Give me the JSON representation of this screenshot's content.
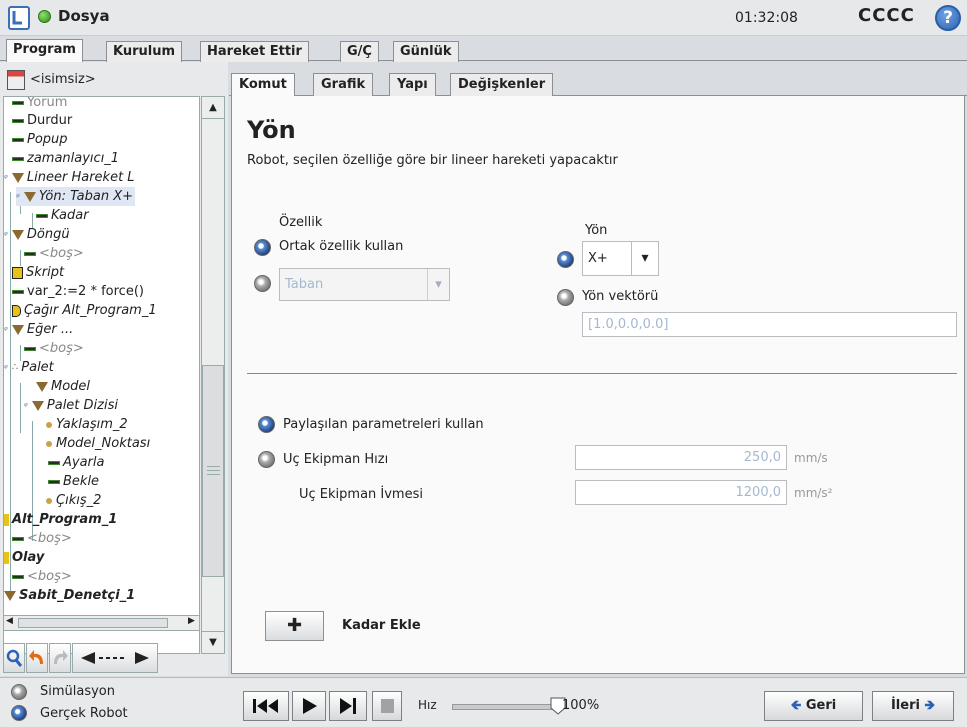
{
  "header": {
    "program_name": "Dosya",
    "clock": "01:32:08",
    "robot_name": "CCCC",
    "help_symbol": "?"
  },
  "main_tabs": [
    "Program",
    "Kurulum",
    "Hareket Ettir",
    "G/Ç",
    "Günlük"
  ],
  "file_name": "<isimsiz>",
  "tree": [
    {
      "label": "Yorum"
    },
    {
      "label": "Durdur"
    },
    {
      "label": "Popup"
    },
    {
      "label": "zamanlayıcı_1"
    },
    {
      "label": "Lineer Hareket L"
    },
    {
      "label": "Yön: Taban X+"
    },
    {
      "label": "Kadar"
    },
    {
      "label": "Döngü"
    },
    {
      "label": "<boş>"
    },
    {
      "label": "Skript"
    },
    {
      "label": "var_2:=2 * force()"
    },
    {
      "label": "Çağır Alt_Program_1"
    },
    {
      "label": "Eğer ..."
    },
    {
      "label": "<boş>"
    },
    {
      "label": "Palet"
    },
    {
      "label": "Model"
    },
    {
      "label": "Palet Dizisi"
    },
    {
      "label": "Yaklaşım_2"
    },
    {
      "label": "Model_Noktası"
    },
    {
      "label": "Ayarla"
    },
    {
      "label": "Bekle"
    },
    {
      "label": "Çıkış_2"
    },
    {
      "label": "Alt_Program_1"
    },
    {
      "label": "<boş>"
    },
    {
      "label": "Olay"
    },
    {
      "label": "<boş>"
    },
    {
      "label": "Sabit_Denetçi_1"
    }
  ],
  "sub_tabs": [
    "Komut",
    "Grafik",
    "Yapı",
    "Değişkenler"
  ],
  "command": {
    "title": "Yön",
    "description": "Robot, seçilen özelliğe göre bir lineer hareketi yapacaktır",
    "feature_label": "Özellik",
    "use_common_feature": "Ortak özellik kullan",
    "feature_value": "Taban",
    "direction_label": "Yön",
    "direction_value": "X+",
    "direction_vector_label": "Yön vektörü",
    "direction_vector_value": "[1.0,0.0,0.0]",
    "shared_params": "Paylaşılan parametreleri kullan",
    "tool_speed_label": "Uç Ekipman Hızı",
    "tool_speed_value": "250,0",
    "tool_speed_unit": "mm/s",
    "tool_accel_label": "Uç Ekipman İvmesi",
    "tool_accel_value": "1200,0",
    "tool_accel_unit": "mm/s²",
    "add_until": "Kadar Ekle"
  },
  "footer": {
    "simulation": "Simülasyon",
    "real_robot": "Gerçek Robot",
    "speed_label": "Hız",
    "speed_value": "100%",
    "speed_fraction": 1.0,
    "back": "Geri",
    "next": "İleri"
  }
}
